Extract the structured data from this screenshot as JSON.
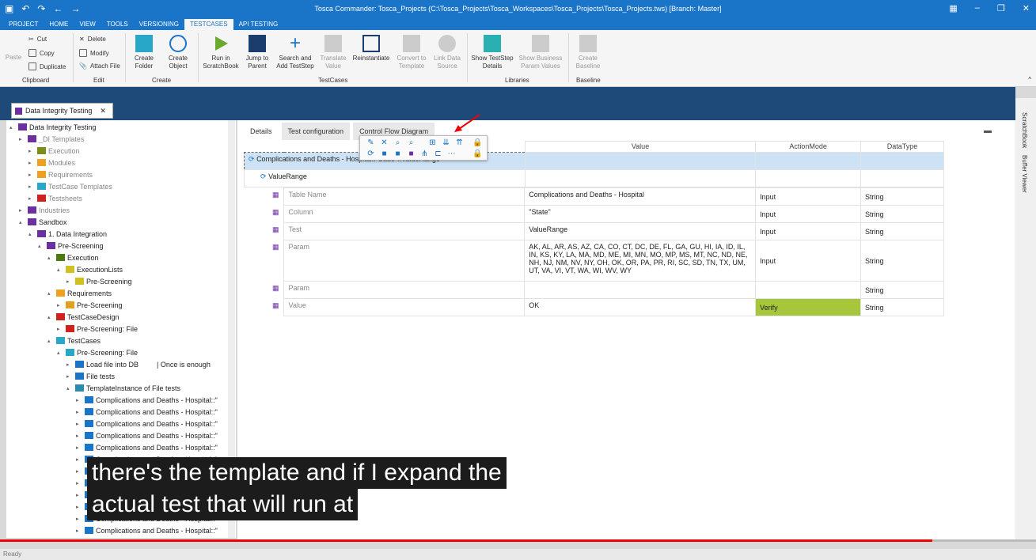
{
  "window": {
    "title": "Tosca Commander: Tosca_Projects (C:\\Tosca_Projects\\Tosca_Workspaces\\Tosca_Projects\\Tosca_Projects.tws) [Branch: Master]"
  },
  "menu_tabs": [
    "PROJECT",
    "HOME",
    "VIEW",
    "TOOLS",
    "VERSIONING",
    "TESTCASES",
    "API TESTING"
  ],
  "ribbon": {
    "paste": "Paste",
    "cut": "Cut",
    "copy": "Copy",
    "duplicate": "Duplicate",
    "clipboard": "Clipboard",
    "delete": "Delete",
    "modify": "Modify",
    "attach": "Attach File",
    "edit": "Edit",
    "create_folder": "Create Folder",
    "create_object": "Create Object",
    "create": "Create",
    "run": "Run in ScratchBook",
    "jump": "Jump to Parent",
    "search_add": "Search and Add TestStep",
    "translate": "Translate Value",
    "reinstantiate": "Reinstantiate",
    "convert": "Convert to Template",
    "link": "Link Data Source",
    "testcases": "TestCases",
    "show_details": "Show TestStep Details",
    "show_business": "Show Business Param Values",
    "libraries": "Libraries",
    "create_baseline": "Create Baseline",
    "baseline": "Baseline"
  },
  "doc_tab": "Data Integrity Testing",
  "tree": [
    "Data Integrity Testing",
    "_DI Templates",
    "Execution",
    "Modules",
    "Requirements",
    "TestCase Templates",
    "Testsheets",
    "Industries",
    "Sandbox",
    "1. Data Integration",
    "Pre-Screening",
    "Execution",
    "ExecutionLists",
    "Pre-Screening",
    "Requirements",
    "Pre-Screening",
    "TestCaseDesign",
    "Pre-Screening: File",
    "TestCases",
    "Pre-Screening: File",
    "Load file into DB",
    "File tests",
    "TemplateInstance of File tests",
    "Complications and Deaths - Hospital::\"",
    "Complications and Deaths - Hospital::\"",
    "Complications and Deaths - Hospital::\"",
    "Complications and Deaths - Hospital::\"",
    "Complications and Deaths - Hospital::\"",
    "Complications and Deaths - Hospital::\"",
    "Complications and Deaths - Hospital::\"",
    "Complications and Deaths - Hospital::\"",
    "Complications and Deaths - Hospital::\"",
    "Complications and Deaths - Hospital::\"",
    "Complications and Deaths - Hospital::\"",
    "Complications and Deaths - Hospital::\""
  ],
  "tree_note": "Once is enough",
  "detail_tabs": [
    "Details",
    "Test configuration",
    "Control Flow Diagram"
  ],
  "grid": {
    "headers": [
      "Value",
      "ActionMode",
      "DataType"
    ],
    "root": "Complications and Deaths - Hospital::\"State\"::ValueRange",
    "module": "ValueRange",
    "rows": [
      {
        "name": "Table Name",
        "value": "Complications and Deaths - Hospital",
        "mode": "Input",
        "type": "String"
      },
      {
        "name": "Column",
        "value": "\"State\"",
        "mode": "Input",
        "type": "String"
      },
      {
        "name": "Test",
        "value": "ValueRange",
        "mode": "Input",
        "type": "String"
      },
      {
        "name": "Param",
        "value": "AK, AL, AR, AS, AZ, CA, CO, CT, DC, DE, FL, GA, GU, HI, IA, ID, IL, IN, KS, KY, LA, MA, MD, ME, MI, MN, MO, MP, MS, MT, NC, ND, NE, NH, NJ, NM, NV, NY, OH, OK, OR, PA, PR, RI, SC, SD, TN, TX, UM, UT, VA, VI, VT, WA, WI, WV, WY",
        "mode": "Input",
        "type": "String"
      },
      {
        "name": "Param",
        "value": "",
        "mode": "",
        "type": "String"
      },
      {
        "name": "Value",
        "value": "OK",
        "mode": "Verify",
        "type": "String"
      }
    ]
  },
  "side": {
    "scratchbook": "ScratchBook",
    "buffer": "Buffer Viewer"
  },
  "caption": {
    "line1": "there's the template and if I expand the",
    "line2": "actual test that will run at"
  },
  "status": "Ready",
  "video_progress": 0.9
}
